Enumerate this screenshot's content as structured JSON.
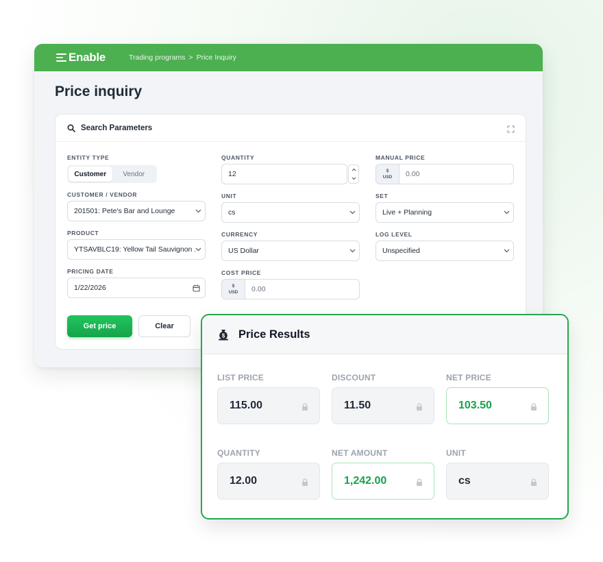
{
  "app": {
    "logo": "Enable",
    "breadcrumb": [
      "Trading programs",
      ">",
      "Price Inquiry"
    ]
  },
  "page_title": "Price inquiry",
  "search": {
    "title": "Search Parameters",
    "entity_type": {
      "label": "ENTITY TYPE",
      "options": [
        "Customer",
        "Vendor"
      ],
      "selected": "Customer"
    },
    "customer_vendor": {
      "label": "CUSTOMER / VENDOR",
      "value": "201501: Pete's Bar and Lounge"
    },
    "product": {
      "label": "PRODUCT",
      "value": "YTSAVBLC19: Yellow Tail Sauvignon ..."
    },
    "pricing_date": {
      "label": "PRICING DATE",
      "value": "1/22/2026"
    },
    "quantity": {
      "label": "QUANTITY",
      "value": "12"
    },
    "unit": {
      "label": "UNIT",
      "value": "cs"
    },
    "currency": {
      "label": "CURRENCY",
      "value": "US Dollar"
    },
    "cost_price": {
      "label": "COST PRICE",
      "currency_symbol": "$",
      "currency_code": "USD",
      "value": "0.00"
    },
    "manual_price": {
      "label": "MANUAL PRICE",
      "currency_symbol": "$",
      "currency_code": "USD",
      "value": "0.00"
    },
    "set": {
      "label": "SET",
      "value": "Live + Planning"
    },
    "log_level": {
      "label": "LOG LEVEL",
      "value": "Unspecified"
    },
    "get_price_label": "Get price",
    "clear_label": "Clear"
  },
  "results": {
    "title": "Price Results",
    "list_price": {
      "label": "LIST PRICE",
      "value": "115.00"
    },
    "discount": {
      "label": "DISCOUNT",
      "value": "11.50"
    },
    "net_price": {
      "label": "NET PRICE",
      "value": "103.50"
    },
    "quantity": {
      "label": "QUANTITY",
      "value": "12.00"
    },
    "net_amount": {
      "label": "NET AMOUNT",
      "value": "1,242.00"
    },
    "unit": {
      "label": "UNIT",
      "value": "cs"
    }
  },
  "colors": {
    "brand_green": "#4caf50",
    "primary_button": "#22c55e",
    "result_border": "#22a84a",
    "highlight_value": "#16a34a"
  },
  "icons": {
    "search": "search-icon",
    "expand": "expand-icon",
    "calendar": "calendar-icon",
    "chevron": "chevron-down-icon",
    "lock": "lock-icon",
    "money_bag": "money-bag-icon"
  }
}
